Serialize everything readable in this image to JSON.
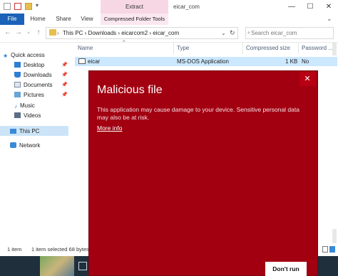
{
  "window": {
    "title": "eicar_com",
    "context_tab": "Extract",
    "controls": {
      "minimize": "—",
      "maximize": "☐",
      "close": "✕"
    }
  },
  "ribbon": {
    "tabs": [
      "File",
      "Home",
      "Share",
      "View"
    ],
    "context_tab": "Compressed Folder Tools"
  },
  "address": {
    "crumbs": "This PC  ›  Downloads  ›  eicarcom2  ›  eicar_com",
    "search_placeholder": "Search eicar_com"
  },
  "nav_pane": {
    "items": [
      {
        "label": "Quick access",
        "icon": "star-icon",
        "pinned": false
      },
      {
        "label": "Desktop",
        "icon": "desktop-icon",
        "pinned": true
      },
      {
        "label": "Downloads",
        "icon": "download-icon",
        "pinned": true
      },
      {
        "label": "Documents",
        "icon": "document-icon",
        "pinned": true
      },
      {
        "label": "Pictures",
        "icon": "picture-icon",
        "pinned": true
      },
      {
        "label": "Music",
        "icon": "music-icon",
        "pinned": false
      },
      {
        "label": "Videos",
        "icon": "video-icon",
        "pinned": false
      },
      {
        "label": "This PC",
        "icon": "computer-icon",
        "pinned": false
      },
      {
        "label": "Network",
        "icon": "network-icon",
        "pinned": false
      }
    ]
  },
  "file_list": {
    "columns": [
      "Name",
      "Type",
      "Compressed size",
      "Password ..."
    ],
    "rows": [
      {
        "name": "eicar",
        "type": "MS-DOS Application",
        "size": "1 KB",
        "password": "No"
      }
    ]
  },
  "status": {
    "count": "1 item",
    "selected": "1 item selected  68 bytes"
  },
  "dialog": {
    "title": "Malicious file",
    "message": "This application may cause damage to your device. Sensitive personal data may also be at risk.",
    "link": "More info",
    "button": "Don't run",
    "close": "✕"
  },
  "colors": {
    "dialog_bg": "#a20011",
    "file_tab": "#1b63b8",
    "selection": "#cce8ff"
  }
}
